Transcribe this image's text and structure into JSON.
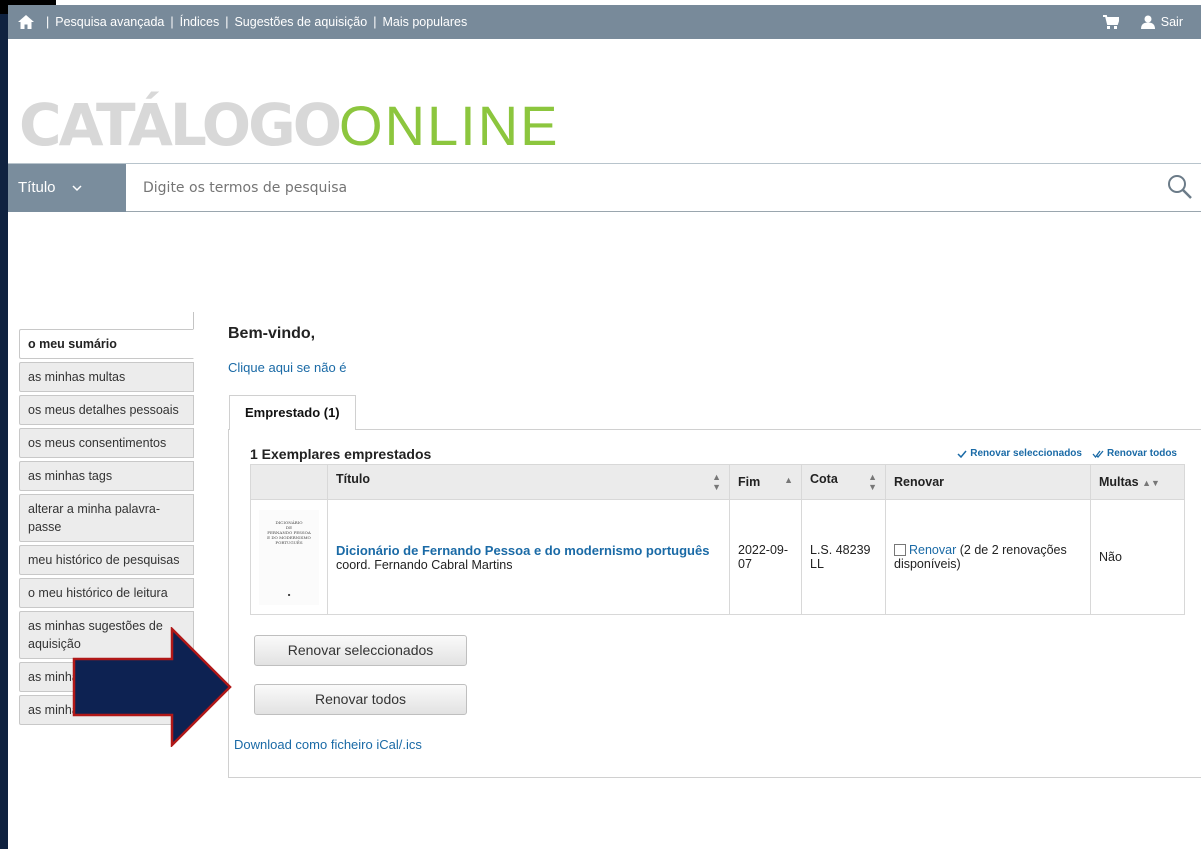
{
  "nav": {
    "links": [
      "Pesquisa avançada",
      "Índices",
      "Sugestões de aquisição",
      "Mais populares"
    ],
    "logout": "Sair",
    "icons": {
      "home": "home-icon",
      "cart": "cart-icon",
      "user": "user-icon"
    }
  },
  "logo": {
    "bold": "CATÁLOGO",
    "light": "ONLINE"
  },
  "search": {
    "type": "Título",
    "placeholder": "Digite os termos de pesquisa"
  },
  "sidebar": {
    "items": [
      "o meu sumário",
      "as minhas multas",
      "os meus detalhes pessoais",
      "os meus consentimentos",
      "as minhas tags",
      "alterar a minha palavra-passe",
      "meu histórico de pesquisas",
      "o meu histórico de leitura",
      "as minhas sugestões de aquisição",
      "as minhas mensagens",
      "as minhas listas"
    ]
  },
  "main": {
    "welcome": "Bem-vindo,",
    "not_me": "Clique aqui se não é",
    "tab_label": "Emprestado (1)",
    "panel_title": "1 Exemplares emprestados",
    "actions": {
      "renew_selected": "Renovar seleccionados",
      "renew_all": "Renovar todos"
    },
    "columns": [
      "Título",
      "Fim",
      "Cota",
      "Renovar",
      "Multas"
    ],
    "loan": {
      "cover_lines": [
        "DICIONÁRIO",
        "DE",
        "FERNANDO PESSOA",
        "E DO MODERNISMO PORTUGUÊS"
      ],
      "title": "Dicionário de Fernando Pessoa e do modernismo português",
      "author": "coord. Fernando Cabral Martins",
      "due": "2022-09-07",
      "callno": "L.S. 48239 LL",
      "renew_link": "Renovar",
      "renew_info": "(2 de 2 renovações disponíveis)",
      "fines": "Não"
    },
    "btn_renew_selected": "Renovar seleccionados",
    "btn_renew_all": "Renovar todos",
    "ical": "Download como ficheiro iCal/.ics"
  },
  "colors": {
    "nav_bg": "#788a9a",
    "link": "#1a6aa6",
    "logo_green": "#8cc63e",
    "arrow": "#0d2252",
    "arrow_border": "#b01818"
  }
}
